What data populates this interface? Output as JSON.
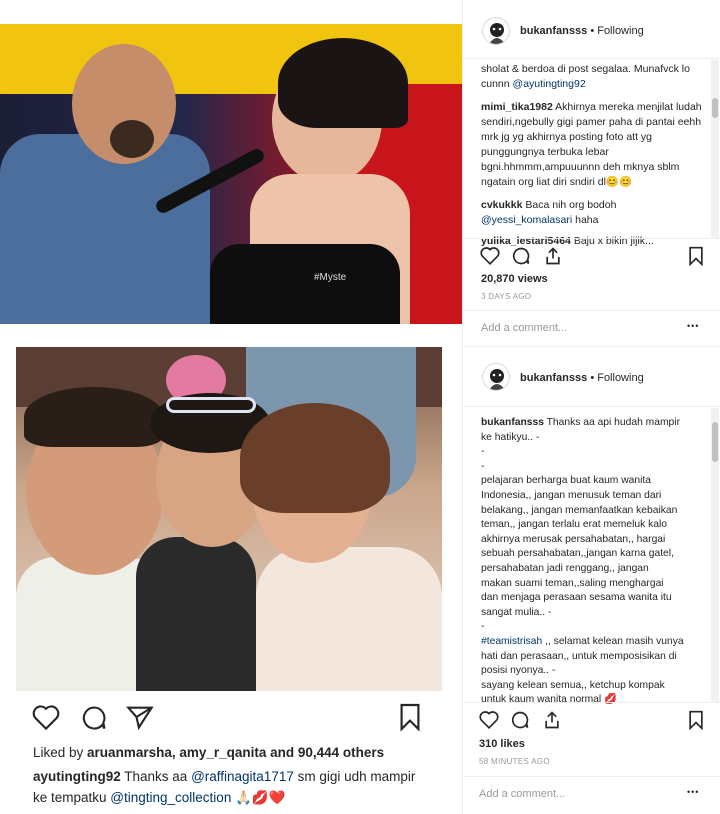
{
  "post1": {
    "watermark": "#Myste",
    "header": {
      "username": "bukanfansss",
      "follow": "• Following"
    },
    "comments": [
      {
        "user": "",
        "text": "sholat & berdoa di post segalaa. Munafvck lo cunnn ",
        "mention": "@ayutingting92"
      },
      {
        "user": "mimi_tika1982",
        "text": "Akhirnya mereka menjilat ludah sendiri,ngebully gigi pamer paha di pantai eehh mrk jg yg akhirnya posting foto att yg punggungnya terbuka lebar bgni.hhmmm,ampuuunnn deh mknya sblm ngatain org liat diri sndiri dl😊😊"
      },
      {
        "user": "cvkukkk",
        "text": "Baca nih org bodoh ",
        "mention": "@yessi_komalasari",
        "after": " haha"
      },
      {
        "user": "yulika_lestari5464",
        "text": "Baju x bikin jijik..."
      }
    ],
    "views": "20,870 views",
    "time": "3 DAYS AGO",
    "add_comment": "Add a comment...",
    "more": "•••"
  },
  "post2": {
    "header": {
      "username": "bukanfansss",
      "follow": "• Following"
    },
    "caption_user": "bukanfansss",
    "caption_lines": [
      "Thanks aa api hudah mampir",
      "ke hatikyu.. -",
      "-",
      "-",
      "pelajaran berharga buat kaum wanita",
      "Indonesia,, jangan menusuk teman dari",
      "belakang,, jangan memanfaatkan kebaikan",
      "teman,, jangan terlalu erat memeluk kalo",
      "akhirnya merusak persahabatan,, hargai",
      "sebuah persahabatan,,jangan karna gatel,",
      "persahabatan jadi renggang,, jangan",
      "makan suami teman,,saling menghargai",
      "dan menjaga perasaan sesama wanita itu",
      "sangat mulia.. -",
      "-"
    ],
    "hashtag": "#teamistrisah",
    "caption_lines2": [
      " ,, selamat kelean masih vunya",
      "hati dan perasaan,, untuk memposisikan di",
      "posisi nyonya.. -",
      "sayang kelean semua,, ketchup kompak",
      "untuk kaum wanita normal 💋"
    ],
    "likes": "310 likes",
    "time": "58 MINUTES AGO",
    "add_comment": "Add a comment...",
    "more": "•••"
  },
  "post3": {
    "liked_prefix": "Liked by ",
    "liked_users": "aruanmarsha, amy_r_qanita",
    "liked_suffix": " and 90,444 others",
    "caption_user": "ayutingting92",
    "caption_text": " Thanks aa ",
    "mention1": "@raffinagita1717",
    "caption_text2": " sm gigi udh mampir",
    "caption_text3": "ke tempatku ",
    "mention2": "@tingting_collection",
    "emoji": " 🙏🏻💋❤️"
  }
}
